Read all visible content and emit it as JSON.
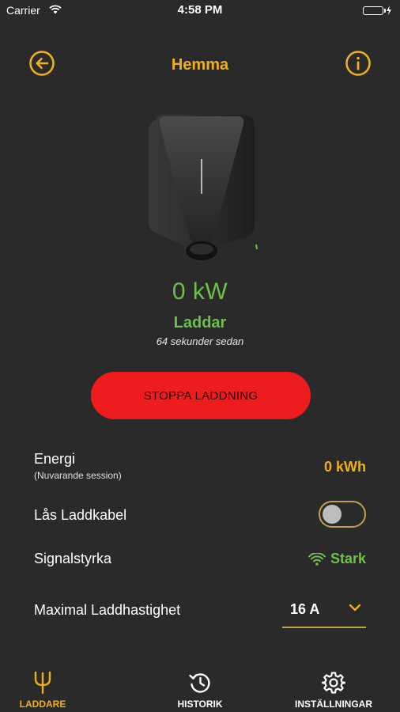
{
  "status_bar": {
    "carrier": "Carrier",
    "time": "4:58 PM",
    "battery_level": 1.0,
    "battery_color": "#4cd964"
  },
  "header": {
    "title": "Hemma",
    "back_icon": "arrow-left-circle-icon",
    "info_icon": "info-circle-icon"
  },
  "charger": {
    "power": "0 kW",
    "status": "Laddar",
    "last_update": "64 sekunder sedan"
  },
  "actions": {
    "stop_label": "STOPPA LADDNING"
  },
  "details": {
    "energy_label": "Energi",
    "energy_sub": "(Nuvarande session)",
    "energy_value": "0 kWh",
    "lock_label": "Lås Laddkabel",
    "lock_enabled": false,
    "signal_label": "Signalstyrka",
    "signal_value": "Stark",
    "max_label": "Maximal Laddhastighet",
    "max_value": "16 A"
  },
  "tabs": [
    {
      "label": "LADDARE",
      "icon": "charger-plug-icon",
      "active": true
    },
    {
      "label": "HISTORIK",
      "icon": "history-clock-icon",
      "active": false
    },
    {
      "label": "INSTÄLLNINGAR",
      "icon": "gear-icon",
      "active": false
    }
  ],
  "colors": {
    "background": "#2a2a2a",
    "accent": "#f0b01c",
    "success": "#6dc14a",
    "danger": "#ee1c1c"
  }
}
